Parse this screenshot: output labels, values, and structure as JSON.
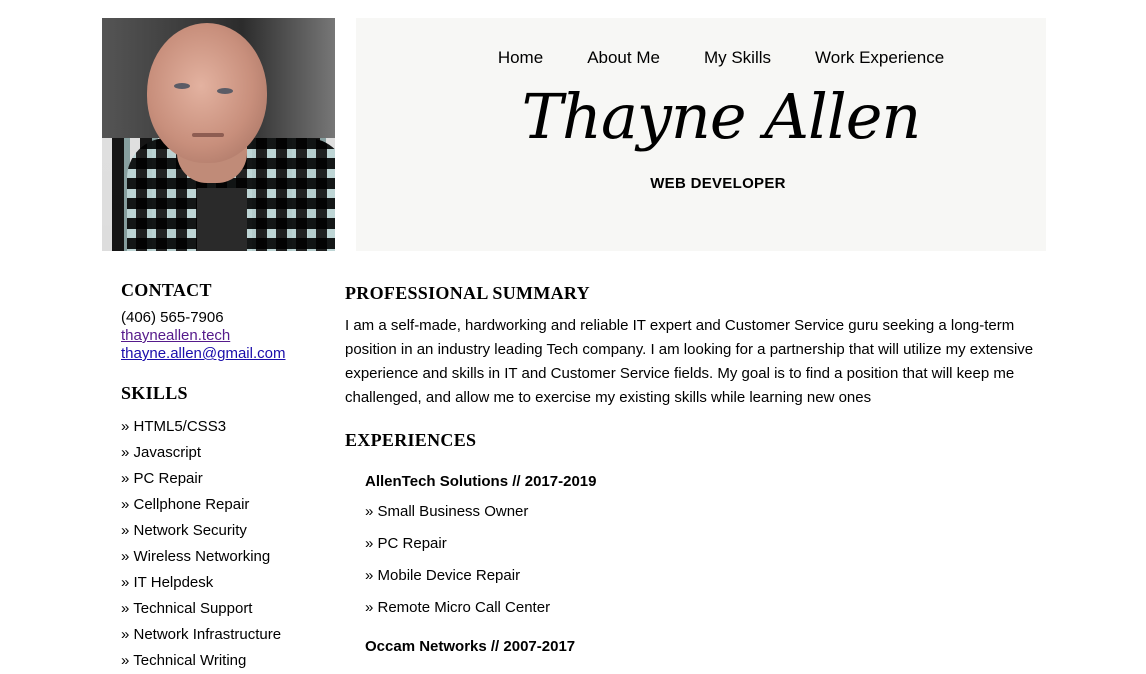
{
  "nav": [
    "Home",
    "About Me",
    "My Skills",
    "Work Experience"
  ],
  "header": {
    "name": "Thayne Allen",
    "role": "WEB DEVELOPER"
  },
  "contact": {
    "heading": "CONTACT",
    "phone": "(406) 565-7906",
    "website": "thayneallen.tech",
    "email": "thayne.allen@gmail.com"
  },
  "skills": {
    "heading": "SKILLS",
    "items": [
      "» HTML5/CSS3",
      "» Javascript",
      "» PC Repair",
      "» Cellphone Repair",
      "» Network Security",
      "» Wireless Networking",
      "» IT Helpdesk",
      "» Technical Support",
      "» Network Infrastructure",
      "» Technical Writing"
    ]
  },
  "summary": {
    "heading": "PROFESSIONAL SUMMARY",
    "text": "I am a self-made, hardworking and reliable IT expert and Customer Service guru seeking a long-term position in an industry leading Tech company. I am looking for a partnership that will utilize my extensive experience and skills in IT and Customer Service fields. My goal is to find a position that will keep me challenged, and allow me to exercise my existing skills while learning new ones"
  },
  "experiences": {
    "heading": "EXPERIENCES",
    "jobs": [
      {
        "title": "AllenTech Solutions // 2017-2019",
        "duties": [
          "» Small Business Owner",
          "» PC Repair",
          "» Mobile Device Repair",
          "» Remote Micro Call Center"
        ]
      },
      {
        "title": "Occam Networks // 2007-2017",
        "duties": []
      }
    ]
  }
}
